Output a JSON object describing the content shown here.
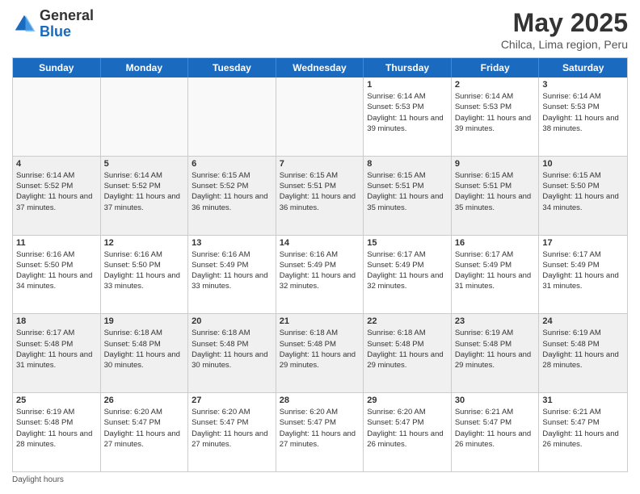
{
  "logo": {
    "general": "General",
    "blue": "Blue"
  },
  "title": "May 2025",
  "subtitle": "Chilca, Lima region, Peru",
  "days_of_week": [
    "Sunday",
    "Monday",
    "Tuesday",
    "Wednesday",
    "Thursday",
    "Friday",
    "Saturday"
  ],
  "footer": "Daylight hours",
  "weeks": [
    [
      {
        "day": "",
        "info": "",
        "empty": true
      },
      {
        "day": "",
        "info": "",
        "empty": true
      },
      {
        "day": "",
        "info": "",
        "empty": true
      },
      {
        "day": "",
        "info": "",
        "empty": true
      },
      {
        "day": "1",
        "info": "Sunrise: 6:14 AM\nSunset: 5:53 PM\nDaylight: 11 hours and 39 minutes."
      },
      {
        "day": "2",
        "info": "Sunrise: 6:14 AM\nSunset: 5:53 PM\nDaylight: 11 hours and 39 minutes."
      },
      {
        "day": "3",
        "info": "Sunrise: 6:14 AM\nSunset: 5:53 PM\nDaylight: 11 hours and 38 minutes."
      }
    ],
    [
      {
        "day": "4",
        "info": "Sunrise: 6:14 AM\nSunset: 5:52 PM\nDaylight: 11 hours and 37 minutes.",
        "shaded": true
      },
      {
        "day": "5",
        "info": "Sunrise: 6:14 AM\nSunset: 5:52 PM\nDaylight: 11 hours and 37 minutes.",
        "shaded": true
      },
      {
        "day": "6",
        "info": "Sunrise: 6:15 AM\nSunset: 5:52 PM\nDaylight: 11 hours and 36 minutes.",
        "shaded": true
      },
      {
        "day": "7",
        "info": "Sunrise: 6:15 AM\nSunset: 5:51 PM\nDaylight: 11 hours and 36 minutes.",
        "shaded": true
      },
      {
        "day": "8",
        "info": "Sunrise: 6:15 AM\nSunset: 5:51 PM\nDaylight: 11 hours and 35 minutes.",
        "shaded": true
      },
      {
        "day": "9",
        "info": "Sunrise: 6:15 AM\nSunset: 5:51 PM\nDaylight: 11 hours and 35 minutes.",
        "shaded": true
      },
      {
        "day": "10",
        "info": "Sunrise: 6:15 AM\nSunset: 5:50 PM\nDaylight: 11 hours and 34 minutes.",
        "shaded": true
      }
    ],
    [
      {
        "day": "11",
        "info": "Sunrise: 6:16 AM\nSunset: 5:50 PM\nDaylight: 11 hours and 34 minutes."
      },
      {
        "day": "12",
        "info": "Sunrise: 6:16 AM\nSunset: 5:50 PM\nDaylight: 11 hours and 33 minutes."
      },
      {
        "day": "13",
        "info": "Sunrise: 6:16 AM\nSunset: 5:49 PM\nDaylight: 11 hours and 33 minutes."
      },
      {
        "day": "14",
        "info": "Sunrise: 6:16 AM\nSunset: 5:49 PM\nDaylight: 11 hours and 32 minutes."
      },
      {
        "day": "15",
        "info": "Sunrise: 6:17 AM\nSunset: 5:49 PM\nDaylight: 11 hours and 32 minutes."
      },
      {
        "day": "16",
        "info": "Sunrise: 6:17 AM\nSunset: 5:49 PM\nDaylight: 11 hours and 31 minutes."
      },
      {
        "day": "17",
        "info": "Sunrise: 6:17 AM\nSunset: 5:49 PM\nDaylight: 11 hours and 31 minutes."
      }
    ],
    [
      {
        "day": "18",
        "info": "Sunrise: 6:17 AM\nSunset: 5:48 PM\nDaylight: 11 hours and 31 minutes.",
        "shaded": true
      },
      {
        "day": "19",
        "info": "Sunrise: 6:18 AM\nSunset: 5:48 PM\nDaylight: 11 hours and 30 minutes.",
        "shaded": true
      },
      {
        "day": "20",
        "info": "Sunrise: 6:18 AM\nSunset: 5:48 PM\nDaylight: 11 hours and 30 minutes.",
        "shaded": true
      },
      {
        "day": "21",
        "info": "Sunrise: 6:18 AM\nSunset: 5:48 PM\nDaylight: 11 hours and 29 minutes.",
        "shaded": true
      },
      {
        "day": "22",
        "info": "Sunrise: 6:18 AM\nSunset: 5:48 PM\nDaylight: 11 hours and 29 minutes.",
        "shaded": true
      },
      {
        "day": "23",
        "info": "Sunrise: 6:19 AM\nSunset: 5:48 PM\nDaylight: 11 hours and 29 minutes.",
        "shaded": true
      },
      {
        "day": "24",
        "info": "Sunrise: 6:19 AM\nSunset: 5:48 PM\nDaylight: 11 hours and 28 minutes.",
        "shaded": true
      }
    ],
    [
      {
        "day": "25",
        "info": "Sunrise: 6:19 AM\nSunset: 5:48 PM\nDaylight: 11 hours and 28 minutes."
      },
      {
        "day": "26",
        "info": "Sunrise: 6:20 AM\nSunset: 5:47 PM\nDaylight: 11 hours and 27 minutes."
      },
      {
        "day": "27",
        "info": "Sunrise: 6:20 AM\nSunset: 5:47 PM\nDaylight: 11 hours and 27 minutes."
      },
      {
        "day": "28",
        "info": "Sunrise: 6:20 AM\nSunset: 5:47 PM\nDaylight: 11 hours and 27 minutes."
      },
      {
        "day": "29",
        "info": "Sunrise: 6:20 AM\nSunset: 5:47 PM\nDaylight: 11 hours and 26 minutes."
      },
      {
        "day": "30",
        "info": "Sunrise: 6:21 AM\nSunset: 5:47 PM\nDaylight: 11 hours and 26 minutes."
      },
      {
        "day": "31",
        "info": "Sunrise: 6:21 AM\nSunset: 5:47 PM\nDaylight: 11 hours and 26 minutes."
      }
    ]
  ]
}
